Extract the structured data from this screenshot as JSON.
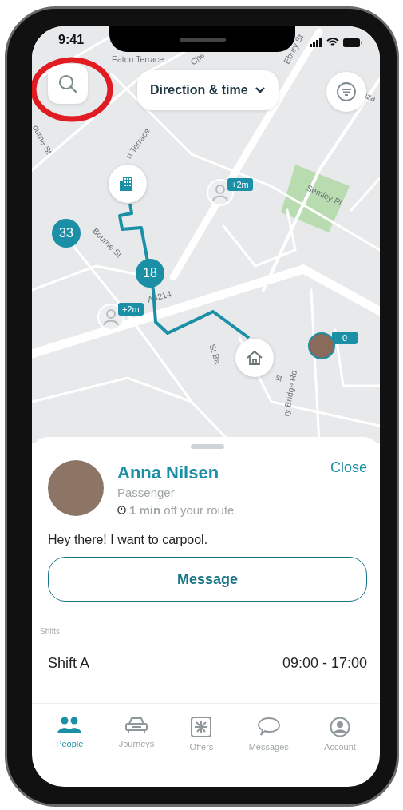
{
  "status_bar": {
    "time": "9:41"
  },
  "map": {
    "direction_button": {
      "label": "Direction & time"
    },
    "labels": [
      "Eaton Terrace",
      "Che",
      "Ebury St",
      "iza",
      "ourne St",
      "n Terrace",
      "Bourne St",
      "Semley Pl",
      "A3214",
      "St Ba",
      "st",
      "ry Bridge Rd"
    ],
    "markers": [
      {
        "kind": "building"
      },
      {
        "kind": "person",
        "badge": "+2m"
      },
      {
        "kind": "cluster",
        "count": "33"
      },
      {
        "kind": "cluster",
        "count": "18"
      },
      {
        "kind": "person",
        "badge": "+2m"
      },
      {
        "kind": "home"
      },
      {
        "kind": "photo",
        "badge": "0"
      }
    ]
  },
  "sheet": {
    "name": "Anna Nilsen",
    "role": "Passenger",
    "detour": "**1 min** off your route",
    "close": "Close",
    "message": "Hey there! I want to carpool.",
    "button": "Message",
    "shifts_heading": "Shifts",
    "shifts": [
      {
        "name": "Shift A",
        "time": "09:00 - 17:00"
      }
    ]
  },
  "tabs": [
    {
      "label": "People",
      "selected": true
    },
    {
      "label": "Journeys",
      "selected": false
    },
    {
      "label": "Offers",
      "selected": false
    },
    {
      "label": "Messages",
      "selected": false
    },
    {
      "label": "Account",
      "selected": false
    }
  ]
}
